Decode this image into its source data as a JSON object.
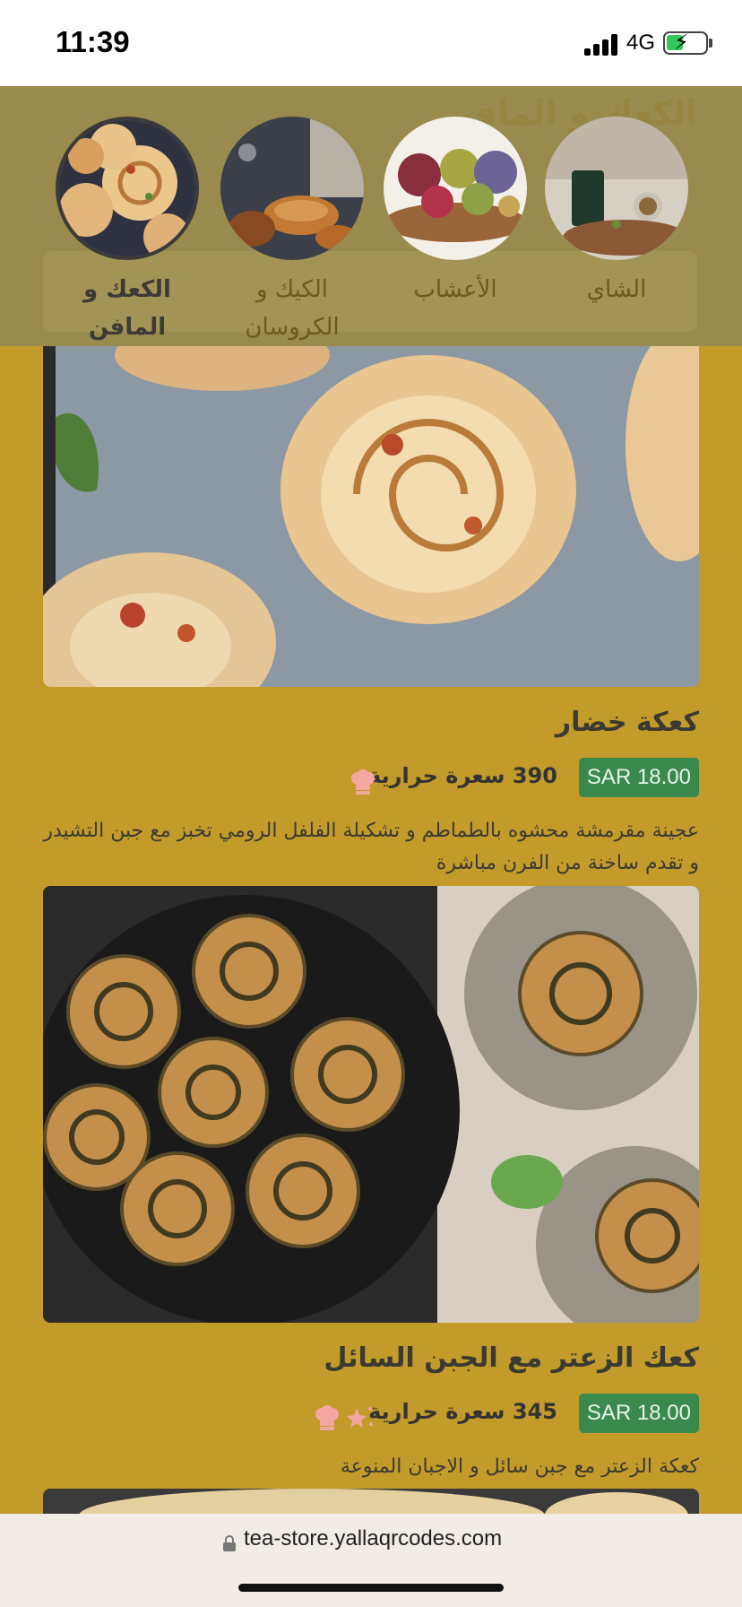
{
  "status_bar": {
    "time": "11:39",
    "network": "4G"
  },
  "category_bar": {
    "ghost_title": "الكعك و المافن",
    "categories": [
      {
        "label": "الكعك و المافن",
        "active": true
      },
      {
        "label": "الكيك و الكروسان",
        "active": false
      },
      {
        "label": "الأعشاب",
        "active": false
      },
      {
        "label": "الشاي",
        "active": false
      }
    ]
  },
  "products": [
    {
      "name": "كعكة خضار",
      "price": "SAR 18.00",
      "calories": "390 سعرة حرارية",
      "badges": [
        "chef-hat-icon"
      ],
      "description": "عجينة مقرمشة محشوه بالطماطم و تشكيلة الفلفل الرومي تخبز مع جبن التشيدر و تقدم ساخنة من الفرن مباشرة"
    },
    {
      "name": "كعك الزعتر مع الجبن السائل",
      "price": "SAR 18.00",
      "calories": "345 سعرة حرارية",
      "badges": [
        "sparkles-icon",
        "chef-hat-icon"
      ],
      "description": "كعكة الزعتر مع جبن سائل و الاجبان المنوعة"
    }
  ],
  "browser": {
    "url": "tea-store.yallaqrcodes.com"
  },
  "colors": {
    "background": "#C39B2A",
    "price_badge": "#3A8A4E",
    "badge_icon": "#F4A6A0"
  }
}
